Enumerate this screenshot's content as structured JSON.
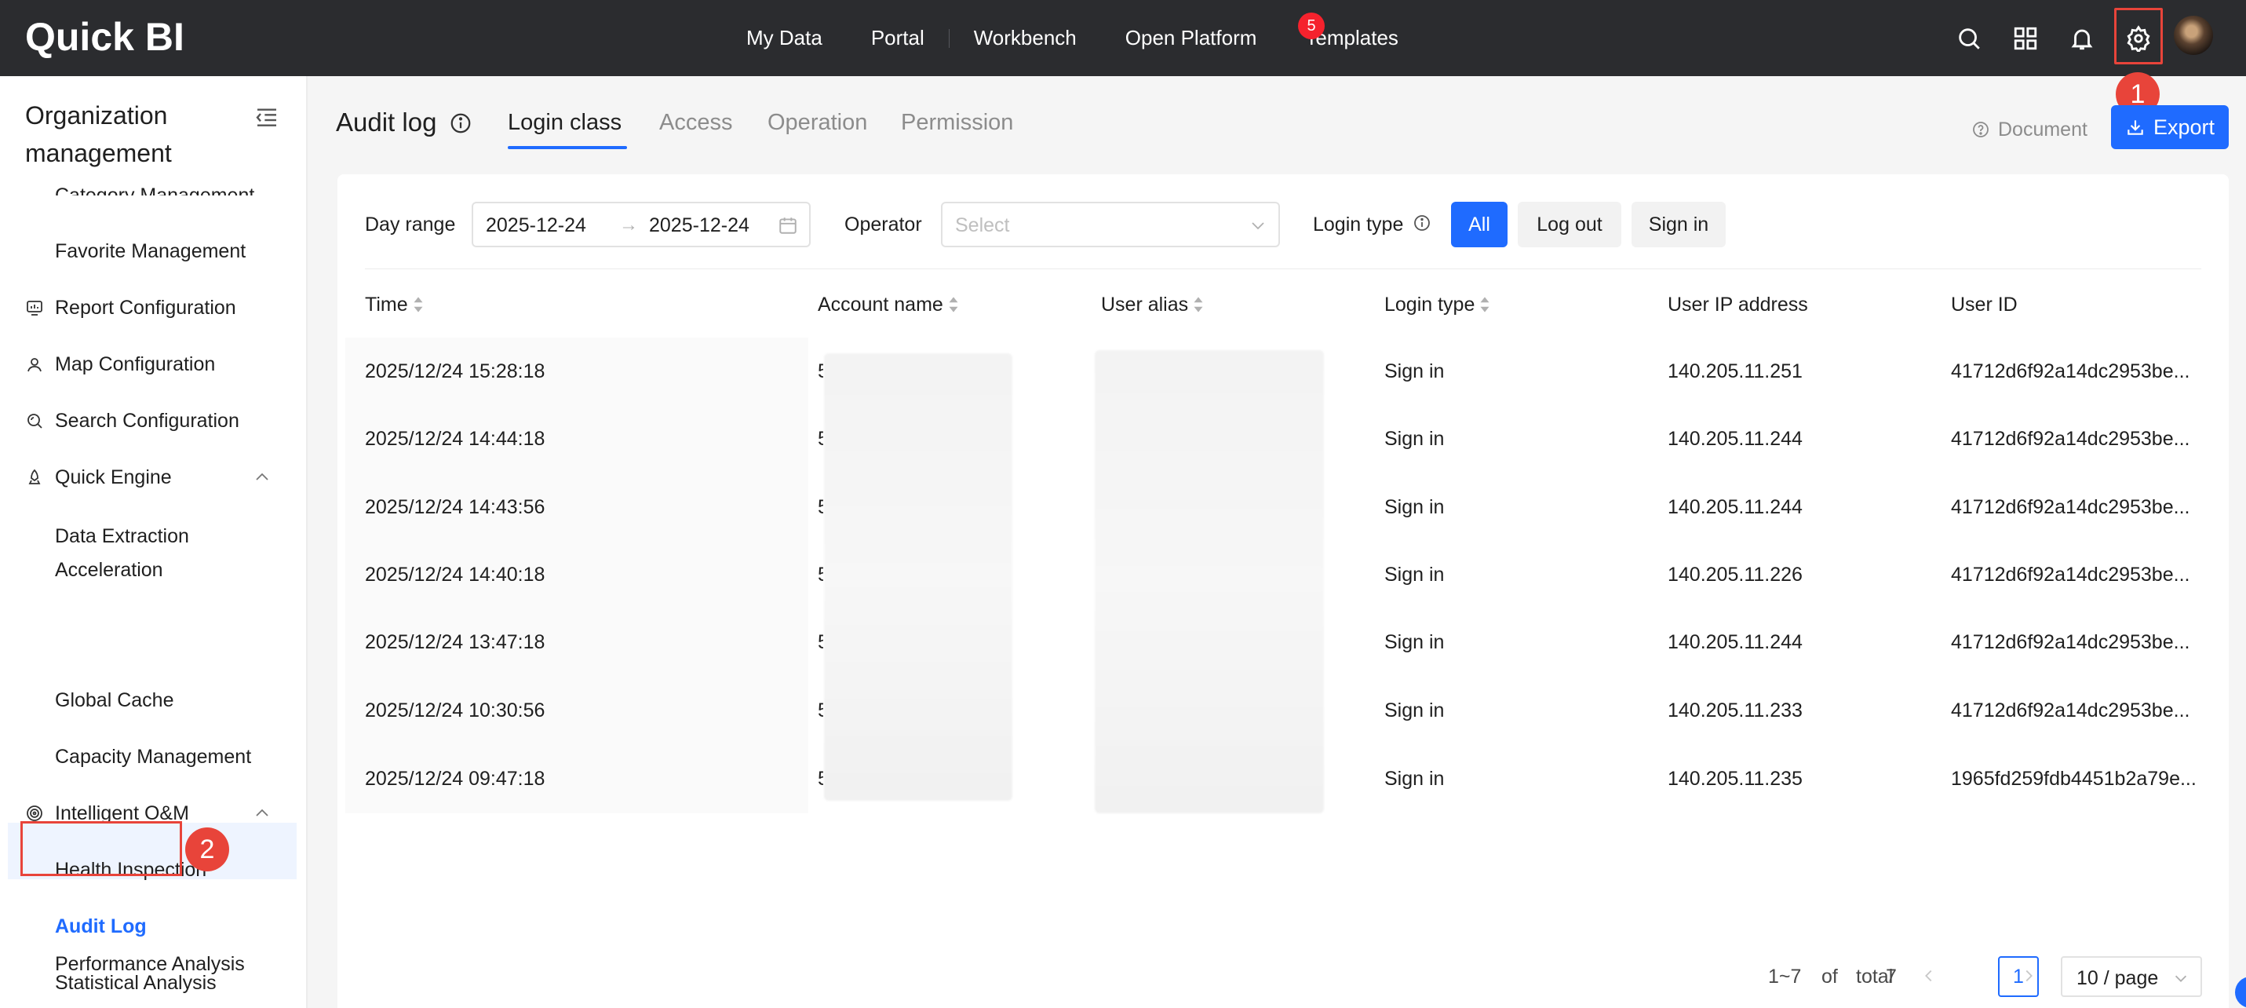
{
  "topbar": {
    "logo": "Quick BI",
    "nav": [
      "My Data",
      "Portal",
      "Workbench",
      "Open Platform",
      "Templates"
    ],
    "icons": [
      "search-icon",
      "apps-grid-icon",
      "bell-icon",
      "gear-icon",
      "avatar"
    ],
    "notification_count": "5"
  },
  "steps": {
    "one": "1",
    "two": "2"
  },
  "sidebar": {
    "title": "Organization management",
    "partial_item": "Category Management",
    "items": [
      {
        "label": "Favorite Management",
        "type": "sub"
      },
      {
        "label": "Report Configuration",
        "type": "group",
        "icon": "report-config-icon"
      },
      {
        "label": "Map Configuration",
        "type": "group",
        "icon": "map-pin-icon"
      },
      {
        "label": "Search Configuration",
        "type": "group",
        "icon": "search-config-icon"
      },
      {
        "label": "Quick Engine",
        "type": "group",
        "icon": "engine-icon",
        "expanded": true
      },
      {
        "label": "Data Extraction Acceleration",
        "type": "sub"
      },
      {
        "label": "Global Cache",
        "type": "sub"
      },
      {
        "label": "Capacity Management",
        "type": "sub"
      },
      {
        "label": "Intelligent O&M",
        "type": "group",
        "icon": "om-icon",
        "expanded": true
      },
      {
        "label": "Health Inspection",
        "type": "sub"
      },
      {
        "label": "Audit Log",
        "type": "sub",
        "active": true
      },
      {
        "label": "Statistical Analysis",
        "type": "sub"
      },
      {
        "label": "Performance Analysis",
        "type": "sub"
      }
    ]
  },
  "header": {
    "title": "Audit log",
    "tabs": [
      "Login class",
      "Access",
      "Operation",
      "Permission"
    ],
    "active_tab": "Login class",
    "document_link": "Document",
    "export_button": "Export"
  },
  "filters": {
    "day_range_label": "Day range",
    "start_date": "2025-12-24",
    "end_date": "2025-12-24",
    "operator_label": "Operator",
    "operator_placeholder": "Select",
    "login_type_label": "Login type",
    "login_type_options": [
      "All",
      "Log out",
      "Sign in"
    ],
    "login_type_selected": "All"
  },
  "table": {
    "columns": [
      "Time",
      "Account name",
      "User alias",
      "Login type",
      "User IP address",
      "User ID"
    ],
    "rows": [
      {
        "time": "2025/12/24 15:28:18",
        "account": "5",
        "login_type": "Sign in",
        "ip": "140.205.11.251",
        "user_id": "41712d6f92a14dc2953be..."
      },
      {
        "time": "2025/12/24 14:44:18",
        "account": "5",
        "login_type": "Sign in",
        "ip": "140.205.11.244",
        "user_id": "41712d6f92a14dc2953be..."
      },
      {
        "time": "2025/12/24 14:43:56",
        "account": "5",
        "login_type": "Sign in",
        "ip": "140.205.11.244",
        "user_id": "41712d6f92a14dc2953be..."
      },
      {
        "time": "2025/12/24 14:40:18",
        "account": "5",
        "login_type": "Sign in",
        "ip": "140.205.11.226",
        "user_id": "41712d6f92a14dc2953be..."
      },
      {
        "time": "2025/12/24 13:47:18",
        "account": "5",
        "login_type": "Sign in",
        "ip": "140.205.11.244",
        "user_id": "41712d6f92a14dc2953be..."
      },
      {
        "time": "2025/12/24 10:30:56",
        "account": "5",
        "login_type": "Sign in",
        "ip": "140.205.11.233",
        "user_id": "41712d6f92a14dc2953be..."
      },
      {
        "time": "2025/12/24 09:47:18",
        "account": "5",
        "login_type": "Sign in",
        "ip": "140.205.11.235",
        "user_id": "1965fd259fdb4451b2a79e..."
      }
    ]
  },
  "pagination": {
    "range": "1~7",
    "of": "of",
    "total_label": "total",
    "total": "7",
    "current_page": "1",
    "page_size": "10 / page"
  },
  "colors": {
    "accent": "#1f6bff",
    "topbar": "#2b2c2f",
    "annotation": "#e8443a",
    "badge": "#f5222d"
  }
}
